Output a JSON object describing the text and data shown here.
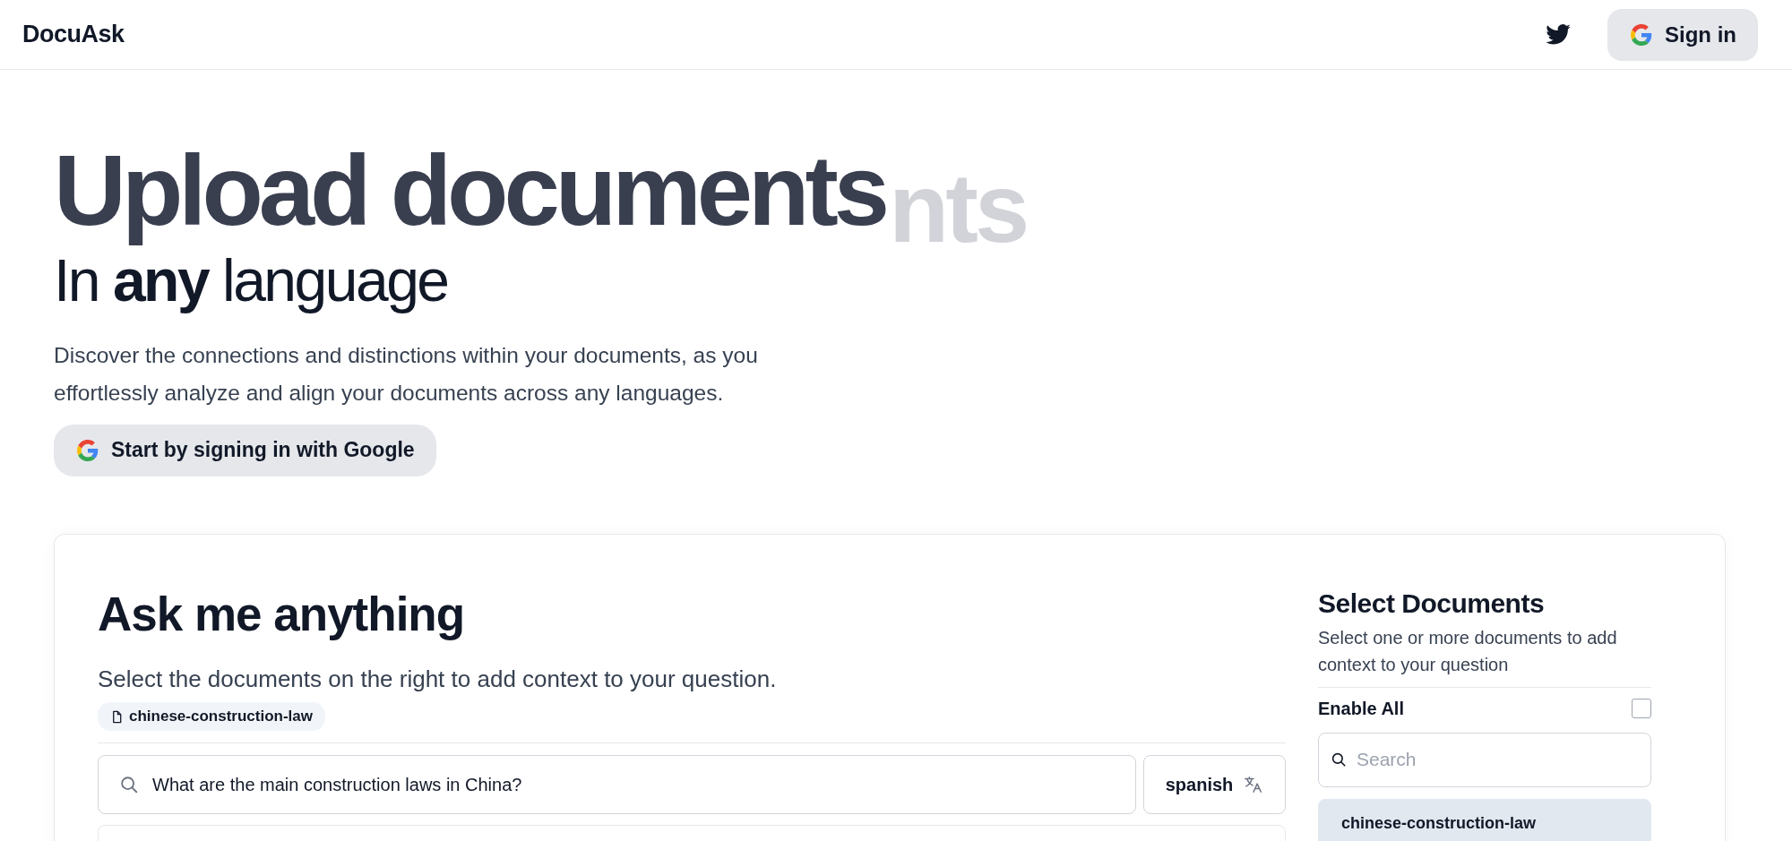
{
  "header": {
    "logo": "DocuAsk",
    "sign_in_button": "Sign in"
  },
  "hero": {
    "title": "Upload documents",
    "title_behind": "nts",
    "subtitle": "In **any** language",
    "description": "Discover the connections and distinctions within your documents, as you effortlessly analyze and align your documents across any languages.",
    "cta_button": "Start by signing in with Google"
  },
  "ask_panel": {
    "title": "Ask me anything",
    "hint": "Select the documents on the right to add context to your question.",
    "context_chips": [
      {
        "label": "chinese-construction-law"
      }
    ],
    "question_field": {
      "value": "What are the main construction laws in China?"
    },
    "language_button": "spanish"
  },
  "documents_panel": {
    "title": "Select Documents",
    "description": "Select one or more documents to add context to your question",
    "enable_all": {
      "label": "Enable All",
      "checked": false
    },
    "search_field": {
      "placeholder": "Search"
    },
    "documents": [
      {
        "name": "chinese-construction-law",
        "selected": true
      }
    ]
  }
}
